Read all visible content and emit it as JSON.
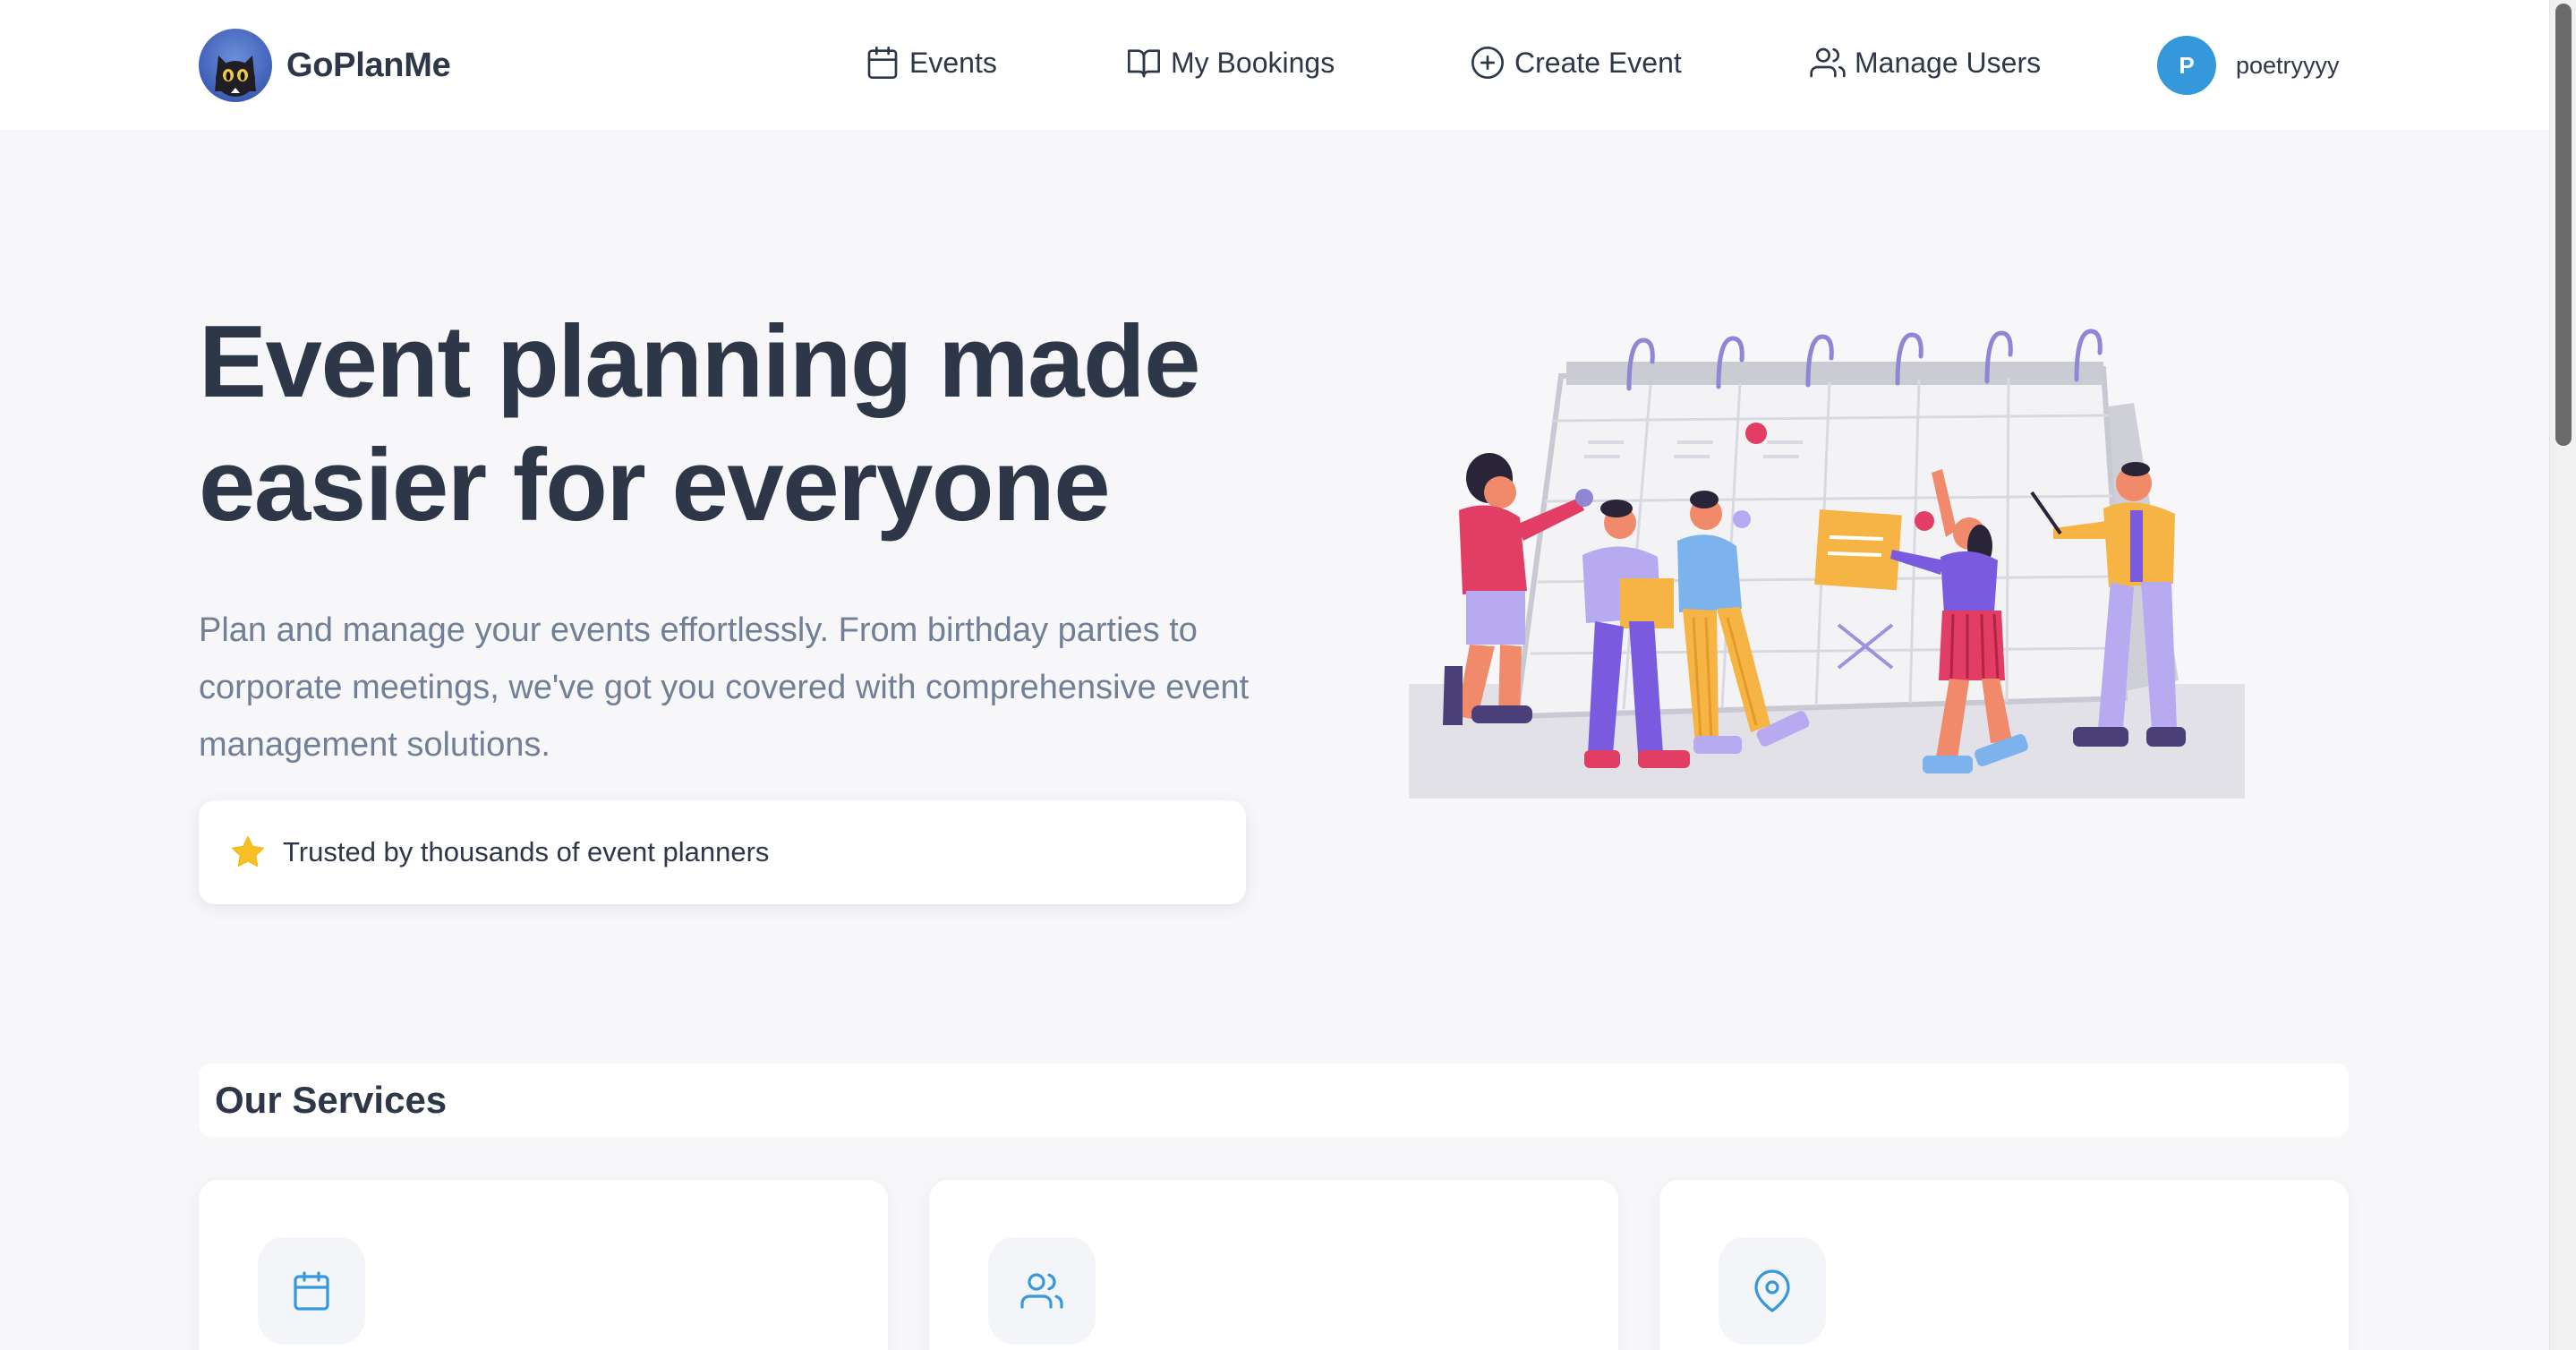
{
  "brand": {
    "name": "GoPlanMe",
    "logo_icon": "cat-logo-icon"
  },
  "nav": {
    "items": [
      {
        "label": "Events",
        "icon": "calendar-icon"
      },
      {
        "label": "My Bookings",
        "icon": "book-open-icon"
      },
      {
        "label": "Create Event",
        "icon": "plus-circle-icon"
      },
      {
        "label": "Manage Users",
        "icon": "users-icon"
      }
    ],
    "user": {
      "initial": "P",
      "username": "poetryyyy"
    }
  },
  "hero": {
    "title_line1": "Event planning made",
    "title_line2": "easier for everyone",
    "description": "Plan and manage your events effortlessly. From birthday parties to corporate meetings, we've got you covered with comprehensive event management solutions.",
    "trust_text": "Trusted by thousands of event planners",
    "trust_icon": "star-icon"
  },
  "services": {
    "title": "Our Services",
    "cards": [
      {
        "icon": "calendar-icon"
      },
      {
        "icon": "users-icon"
      },
      {
        "icon": "map-pin-icon"
      }
    ]
  },
  "colors": {
    "accent": "#3498db",
    "text_dark": "#2d3748",
    "text_muted": "#718096",
    "background": "#f7f6f9",
    "star": "#f6c026"
  }
}
